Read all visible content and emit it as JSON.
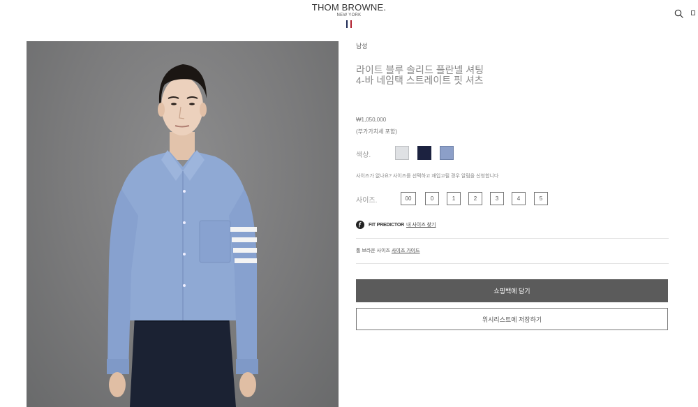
{
  "header": {
    "brand": "THOM BROWNE.",
    "brand_sub": "NEW YORK",
    "flag_colors": [
      "#1e2a55",
      "#ffffff",
      "#b01f2e"
    ],
    "search_icon": "search-icon",
    "bag_icon": "shopping-bag-icon"
  },
  "product": {
    "category": "남성",
    "title": "라이트 블루 솔리드 플란넬 셔팅 4-바 네임택 스트레이트 핏 셔츠",
    "price": "₩1,050,000",
    "vat_note": "(부가가치세 포함)",
    "color_label": "색상.",
    "colors": [
      {
        "name": "light-grey",
        "hex": "#dfe1e4"
      },
      {
        "name": "navy",
        "hex": "#1c2240"
      },
      {
        "name": "light-blue",
        "hex": "#8c9fc8"
      }
    ],
    "size_notice": "사이즈가 없나요? 사이즈를 선택하고 재입고될 경우 알림을 신청합니다",
    "size_label": "사이즈.",
    "sizes": [
      "00",
      "0",
      "1",
      "2",
      "3",
      "4",
      "5"
    ],
    "fit_predictor": "FIT PREDICTOR",
    "fit_link": "내 사이즈 찾기",
    "guide_prefix": "톰 브라운 사이즈",
    "guide_link": "사이즈 가이드",
    "add_to_bag": "쇼핑백에 담기",
    "add_to_wishlist": "위시리스트에 저장하기"
  },
  "colors": {
    "primary_button": "#5b5b5b",
    "photo_background": "#7f8081",
    "shirt": "#8fa9d4",
    "trousers": "#1b2233"
  }
}
